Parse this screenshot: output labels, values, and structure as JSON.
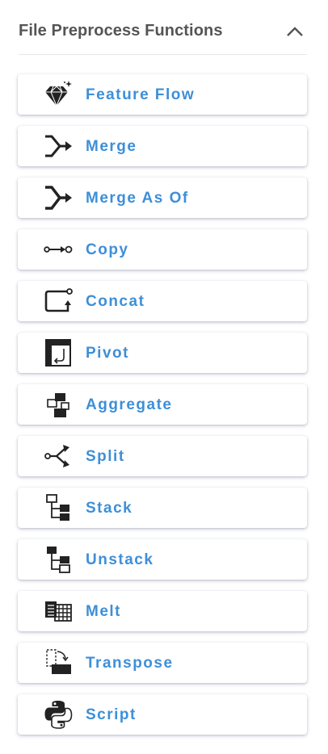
{
  "header": {
    "title": "File Preprocess Functions"
  },
  "items": [
    {
      "label": "Feature Flow",
      "icon": "diamond-icon"
    },
    {
      "label": "Merge",
      "icon": "merge-icon"
    },
    {
      "label": "Merge As Of",
      "icon": "merge-as-of-icon"
    },
    {
      "label": "Copy",
      "icon": "copy-icon"
    },
    {
      "label": "Concat",
      "icon": "concat-icon"
    },
    {
      "label": "Pivot",
      "icon": "pivot-icon"
    },
    {
      "label": "Aggregate",
      "icon": "aggregate-icon"
    },
    {
      "label": "Split",
      "icon": "split-icon"
    },
    {
      "label": "Stack",
      "icon": "stack-icon"
    },
    {
      "label": "Unstack",
      "icon": "unstack-icon"
    },
    {
      "label": "Melt",
      "icon": "melt-icon"
    },
    {
      "label": "Transpose",
      "icon": "transpose-icon"
    },
    {
      "label": "Script",
      "icon": "python-icon"
    }
  ],
  "colors": {
    "label": "#3d8fd8",
    "title": "#555555",
    "icon": "#222222"
  }
}
